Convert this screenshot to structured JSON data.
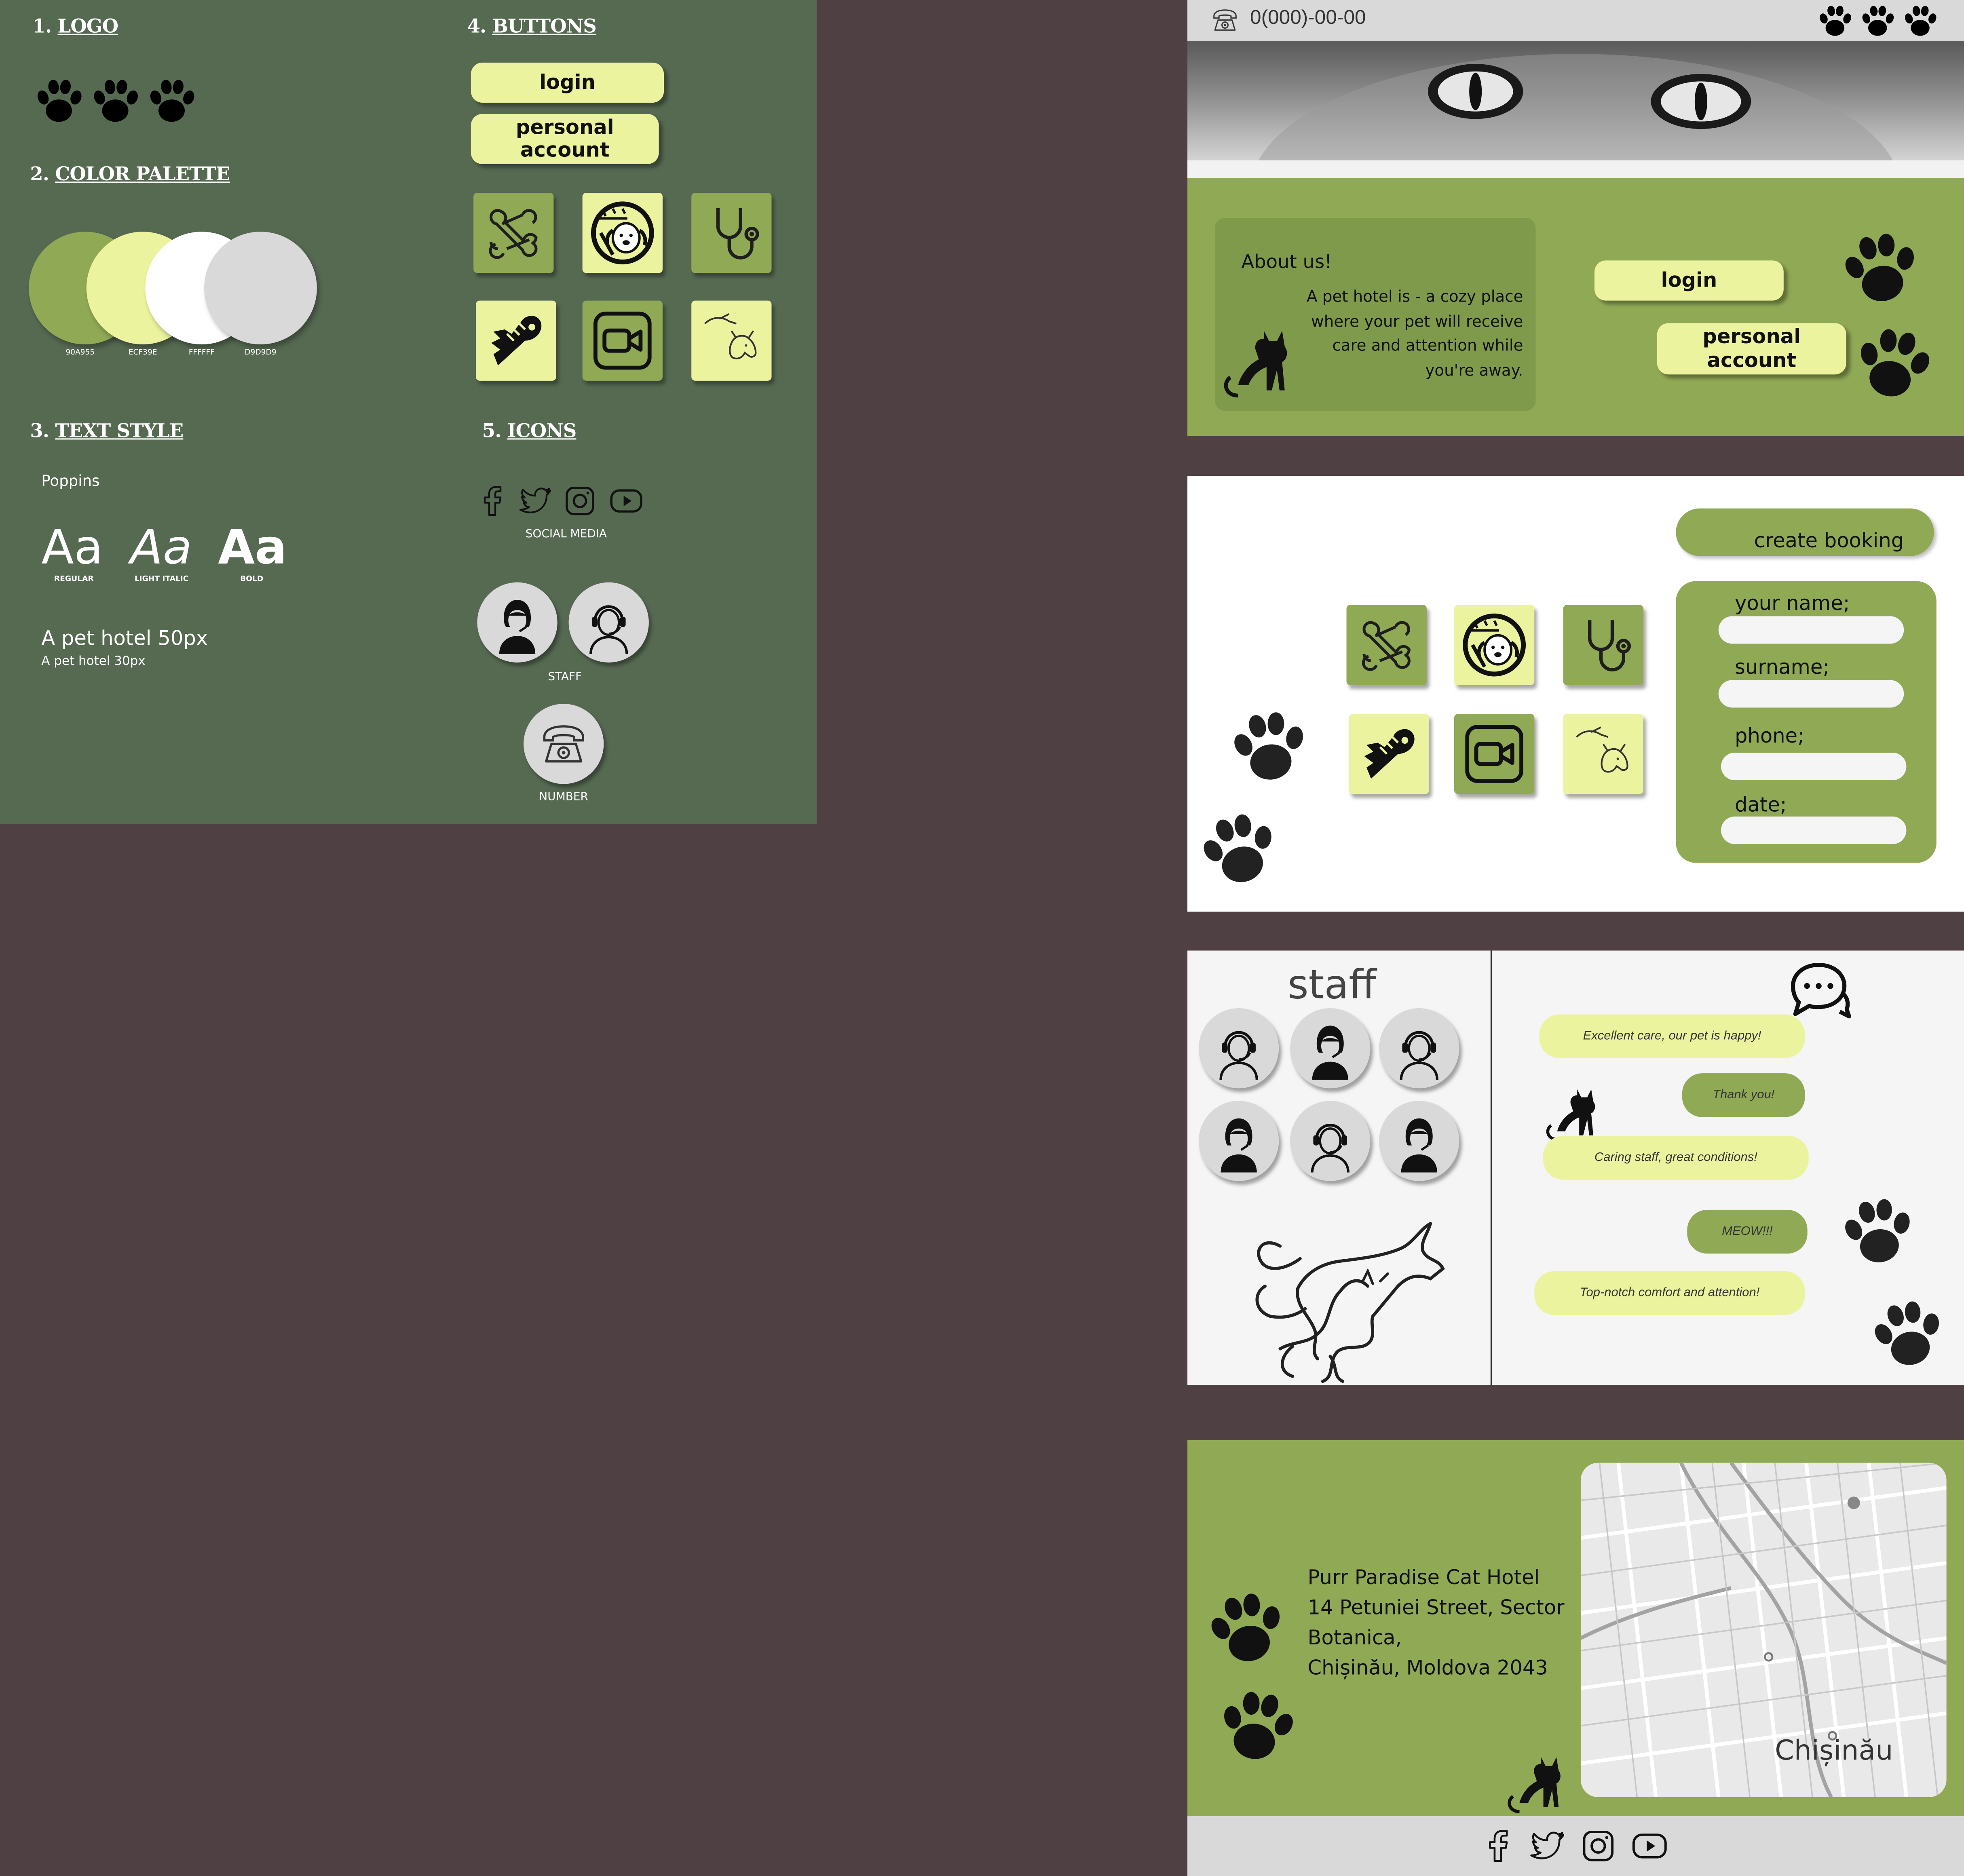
{
  "guide": {
    "logo_title": "LOGO",
    "palette_title": "COLOR PALETTE",
    "palette": [
      {
        "hex": "#90A955",
        "label": "90A955"
      },
      {
        "hex": "#ECF39E",
        "label": "ECF39E"
      },
      {
        "hex": "#FFFFFF",
        "label": "FFFFFF"
      },
      {
        "hex": "#D9D9D9",
        "label": "D9D9D9"
      }
    ],
    "text_title": "TEXT STYLE",
    "font_name": "Poppins",
    "samples": [
      {
        "glyph": "Aa",
        "label": "REGULAR"
      },
      {
        "glyph": "Aa",
        "label": "LIGHT ITALIC"
      },
      {
        "glyph": "Aa",
        "label": "BOLD"
      }
    ],
    "size_large": "A pet hotel 50px",
    "size_small": "A pet hotel 30px",
    "buttons_title": "BUTTONS",
    "login": "login",
    "personal_account": "personal account",
    "icons_title": "ICONS",
    "social_caption": "SOCIAL MEDIA",
    "staff_caption": "STAFF",
    "number_caption": "NUMBER",
    "n1": "1.",
    "n2": "2.",
    "n3": "3.",
    "n4": "4.",
    "n5": "5."
  },
  "header": {
    "phone": "0(000)-00-00",
    "icons": [
      "phone-icon",
      "paw-icon",
      "paw-icon",
      "paw-icon"
    ]
  },
  "about": {
    "title": "About us!",
    "text": "A pet hotel is - a cozy place where your pet will receive care and attention while you're away.",
    "login": "login",
    "personal_account": "personal account"
  },
  "booking": {
    "create_label": "create  booking",
    "fields": [
      {
        "label": "your name;"
      },
      {
        "label": "surname;"
      },
      {
        "label": "phone;"
      },
      {
        "label": "date;"
      }
    ],
    "services": [
      "bone-icon",
      "grooming-icon",
      "stethoscope-icon",
      "fish-bone-icon",
      "video-camera-icon",
      "pet-care-icon"
    ]
  },
  "staff": {
    "title": "staff"
  },
  "reviews": [
    {
      "text": "Excellent care, our pet is happy!",
      "style": "light"
    },
    {
      "text": "Thank you!",
      "style": "green"
    },
    {
      "text": "Caring staff, great conditions!",
      "style": "light"
    },
    {
      "text": "MEOW!!!",
      "style": "green"
    },
    {
      "text": "Top-notch comfort and attention!",
      "style": "light"
    }
  ],
  "contact": {
    "line1": "Purr Paradise Cat Hotel",
    "line2": "14 Petuniei Street, Sector",
    "line3": "Botanica,",
    "line4": "Chișinău, Moldova 2043",
    "map_label": "Chișinău"
  },
  "footer": {
    "social": [
      "facebook-icon",
      "twitter-icon",
      "instagram-icon",
      "youtube-icon"
    ]
  },
  "colors": {
    "accent_green": "#90A955",
    "light_yellow": "#ECF39E",
    "white": "#FFFFFF",
    "grey": "#D9D9D9",
    "guide_bg": "#566A52",
    "page_bg": "#4E4043"
  }
}
